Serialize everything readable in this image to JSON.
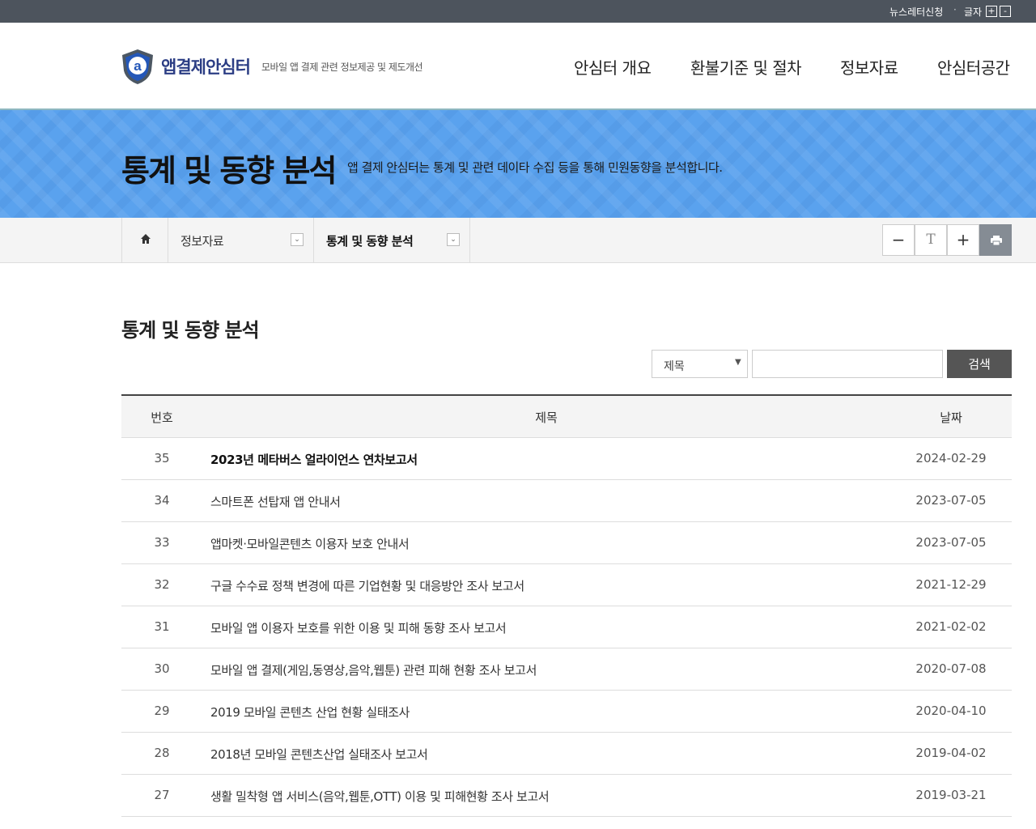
{
  "topbar": {
    "newsletter": "뉴스레터신청",
    "separator": "·",
    "font_label": "글자",
    "font_plus": "+",
    "font_minus": "-"
  },
  "header": {
    "logo_text": "앱결제안심터",
    "logo_sub": "모바일 앱 결제 관련 정보제공 및 제도개선",
    "logo_icon": "shield-a-icon",
    "nav": [
      "안심터 개요",
      "환불기준 및 절차",
      "정보자료",
      "안심터공간"
    ]
  },
  "banner": {
    "title": "통계 및 동향 분석",
    "description": "앱 결제 안심터는 통계 및 관련 데이타 수집 등을 통해 민원동향을 분석합니다."
  },
  "location": {
    "home_icon": "home-icon",
    "items": [
      "정보자료",
      "통계 및 동향 분석"
    ]
  },
  "tools": {
    "minus": "−",
    "reset": "T",
    "plus": "+",
    "print_icon": "print-icon"
  },
  "content": {
    "title": "통계 및 동향 분석",
    "search": {
      "select_value": "제목",
      "input_value": "",
      "button": "검색"
    },
    "columns": {
      "num": "번호",
      "title": "제목",
      "date": "날짜"
    },
    "rows": [
      {
        "num": "35",
        "title": "2023년 메타버스 얼라이언스 연차보고서",
        "date": "2024-02-29"
      },
      {
        "num": "34",
        "title": "스마트폰 선탑재 앱 안내서",
        "date": "2023-07-05"
      },
      {
        "num": "33",
        "title": "앱마켓·모바일콘텐츠 이용자 보호 안내서",
        "date": "2023-07-05"
      },
      {
        "num": "32",
        "title": "구글 수수료 정책 변경에 따른 기업현황 및 대응방안 조사 보고서",
        "date": "2021-12-29"
      },
      {
        "num": "31",
        "title": "모바일 앱 이용자 보호를 위한 이용 및 피해 동향 조사 보고서",
        "date": "2021-02-02"
      },
      {
        "num": "30",
        "title": "모바일 앱 결제(게임,동영상,음악,웹툰) 관련 피해 현황 조사 보고서",
        "date": "2020-07-08"
      },
      {
        "num": "29",
        "title": "2019 모바일 콘텐츠 산업 현황 실태조사",
        "date": "2020-04-10"
      },
      {
        "num": "28",
        "title": "2018년 모바일 콘텐츠산업 실태조사 보고서",
        "date": "2019-04-02"
      },
      {
        "num": "27",
        "title": "생활 밀착형 앱 서비스(음악,웹툰,OTT) 이용 및 피해현황 조사 보고서",
        "date": "2019-03-21"
      }
    ]
  },
  "colors": {
    "topbar": "#4d545d",
    "brand": "#2b3d84",
    "banner": "#5aa2ee",
    "search_button": "#555555"
  }
}
